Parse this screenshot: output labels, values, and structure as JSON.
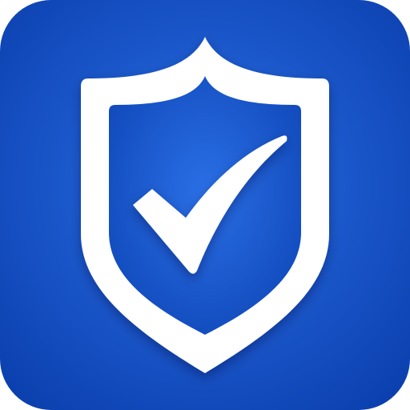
{
  "icon": {
    "name": "shield-check-icon",
    "colors": {
      "background_center": "#2a6fe6",
      "background_edge": "#0b3fae",
      "shield_outline": "#ffffff",
      "shield_fill_center": "#2a6fe6",
      "shield_fill_edge": "#0f47b8",
      "checkmark": "#ffffff"
    }
  }
}
